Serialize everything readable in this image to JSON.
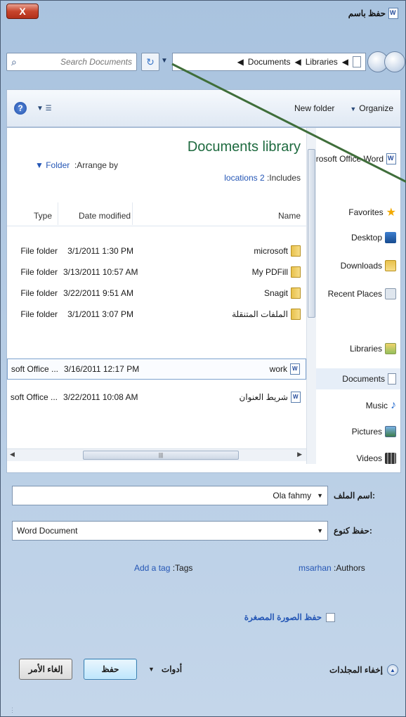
{
  "window": {
    "title": "حفظ باسم",
    "close_label": "X"
  },
  "address": {
    "search_placeholder": "Search Documents",
    "crumbs": [
      "Documents",
      "Libraries"
    ]
  },
  "toolbar": {
    "new_folder": "New folder",
    "organize": "Organize"
  },
  "library": {
    "title": "Documents library",
    "includes_prefix": ":Includes",
    "locations_link": "locations 2",
    "arrange_label": ":Arrange by",
    "arrange_value": "Folder"
  },
  "columns": {
    "type": "Type",
    "date": "Date modified",
    "name": "Name"
  },
  "files": [
    {
      "type": "File folder",
      "date": "3/1/2011 1:30 PM",
      "name": "microsoft",
      "icon": "folder-icon"
    },
    {
      "type": "File folder",
      "date": "3/13/2011 10:57 AM",
      "name": "My PDFill",
      "icon": "folder-icon"
    },
    {
      "type": "File folder",
      "date": "3/22/2011 9:51 AM",
      "name": "Snagit",
      "icon": "folder-icon"
    },
    {
      "type": "File folder",
      "date": "3/1/2011 3:07 PM",
      "name": "الملفات المتنقلة",
      "icon": "folder-icon"
    },
    {
      "type": "soft Office ...",
      "date": "3/16/2011 12:17 PM",
      "name": "work",
      "icon": "word-doc-icon"
    },
    {
      "type": "soft Office ...",
      "date": "3/22/2011 10:08 AM",
      "name": "شريط العنوان",
      "icon": "word-doc-icon"
    }
  ],
  "nav": {
    "app": "rosoft Office Word",
    "favorites": "Favorites",
    "desktop": "Desktop",
    "downloads": "Downloads",
    "recent": "Recent Places",
    "libraries": "Libraries",
    "documents": "Documents",
    "music": "Music",
    "pictures": "Pictures",
    "videos": "Videos"
  },
  "form": {
    "filename_label": "اسم الملف:",
    "filename_value": "Ola fahmy",
    "savetype_label": "حفظ كنوع:",
    "savetype_value": "Word Document",
    "authors_label": ":Authors",
    "authors_value": "msarhan",
    "tags_label": ":Tags",
    "tags_value": "Add a tag",
    "thumbnail_label": "حفظ الصورة المصغرة"
  },
  "buttons": {
    "save": "حفظ",
    "cancel": "إلغاء الأمر",
    "tools": "أدوات",
    "hide_folders": "إخفاء المجلدات"
  },
  "colors": {
    "accent_link": "#2456b5",
    "library_title": "#1e6a3f",
    "annotation_line": "#3f6e3a"
  }
}
